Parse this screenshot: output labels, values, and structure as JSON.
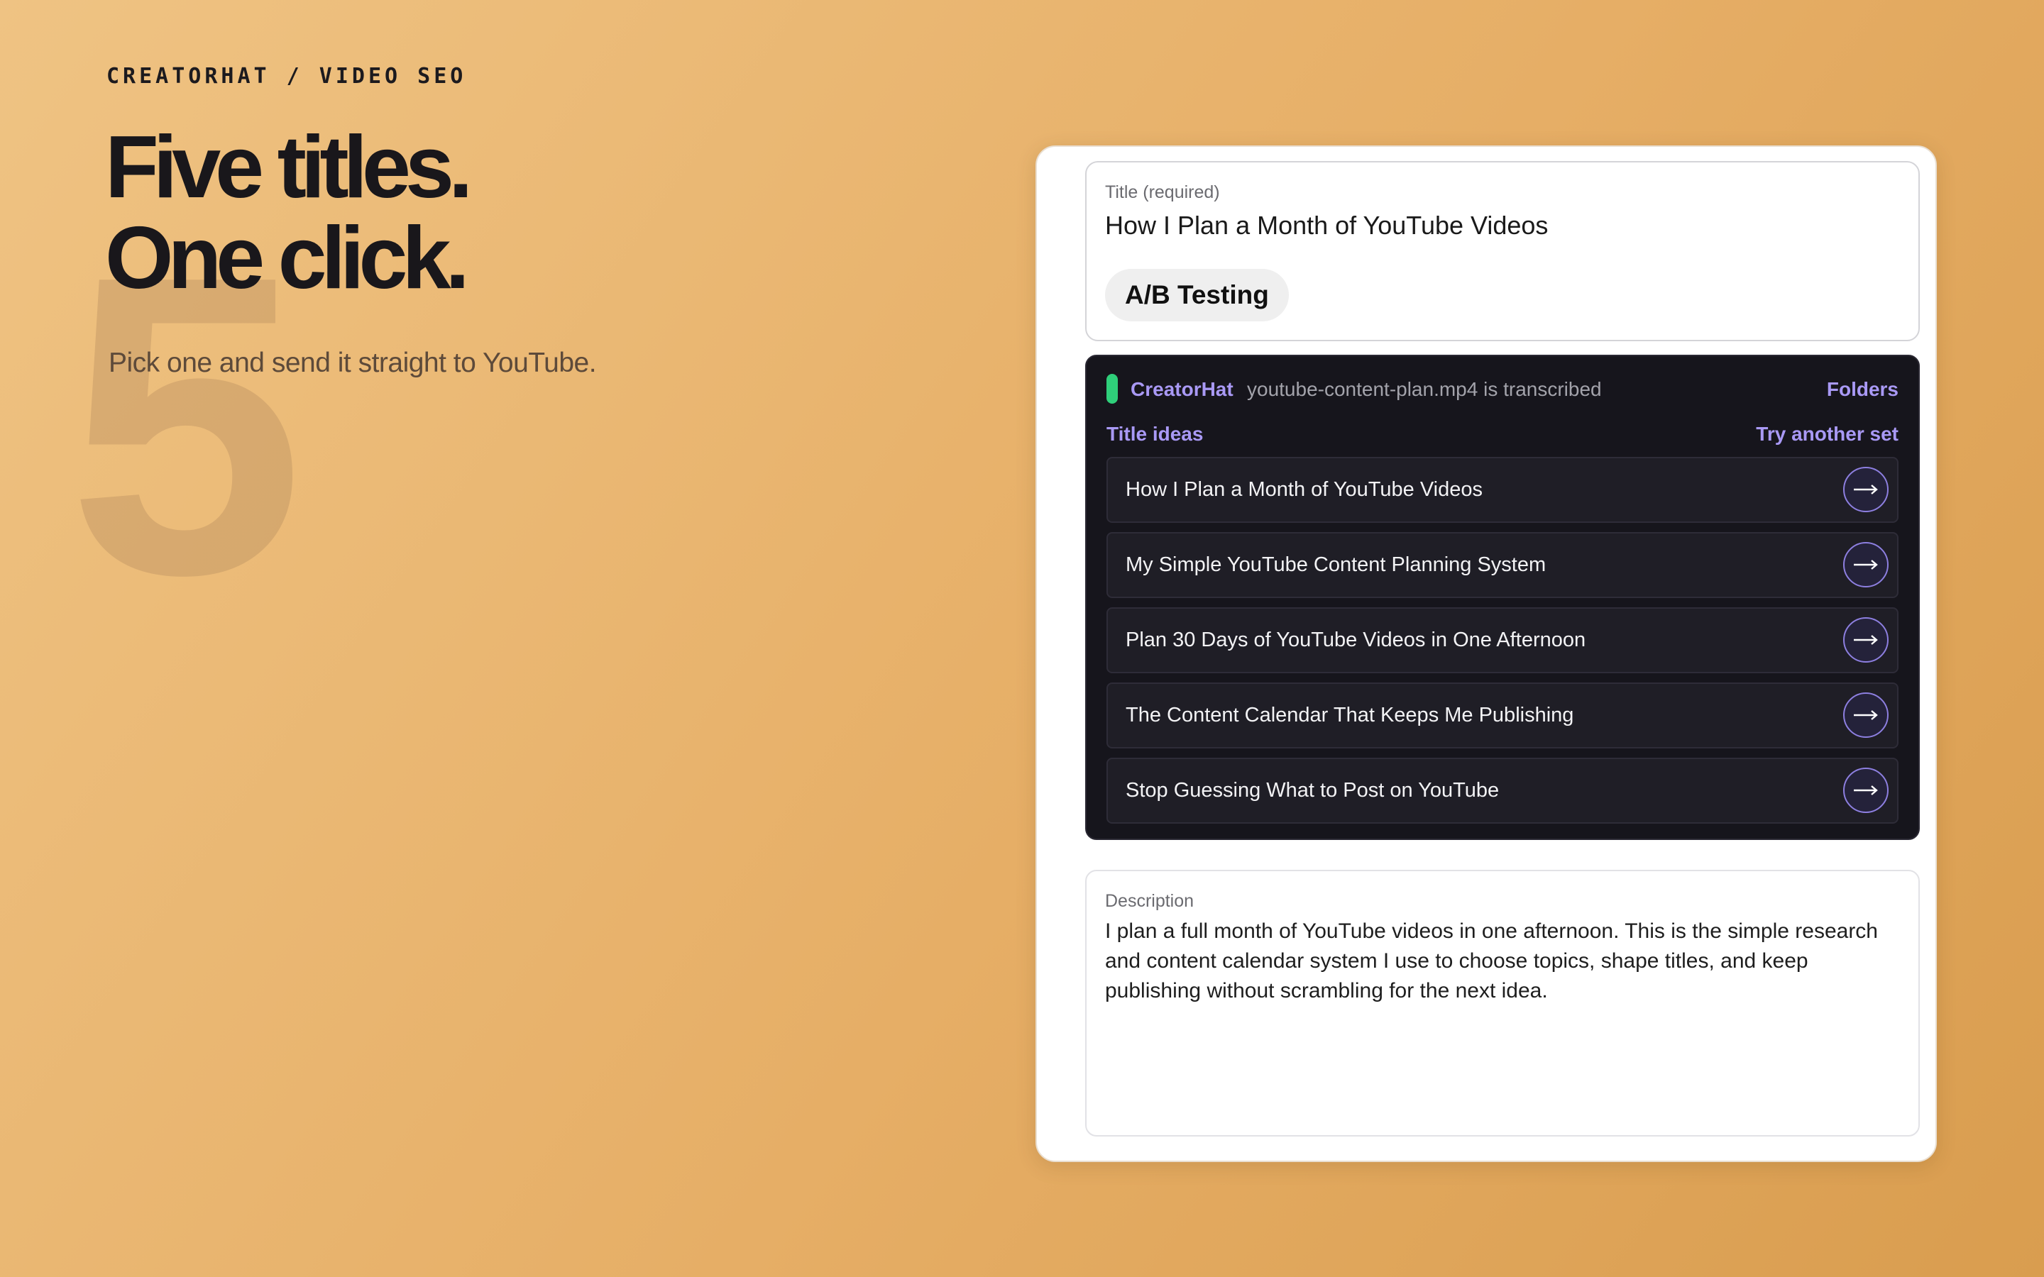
{
  "hero": {
    "eyebrow": "CREATORHAT / VIDEO SEO",
    "watermark_number": "5",
    "headline_line1": "Five titles.",
    "headline_line2": "One click.",
    "subhead": "Pick one and send it straight to YouTube."
  },
  "editor": {
    "title_label": "Title (required)",
    "title_value": "How I Plan a Month of YouTube Videos",
    "ab_testing_label": "A/B Testing",
    "assistant": {
      "brand": "CreatorHat",
      "status": "youtube-content-plan.mp4 is transcribed",
      "folders_link": "Folders",
      "ideas_heading": "Title ideas",
      "try_another_link": "Try another set",
      "status_color": "#2fcf7a",
      "accent_color": "#a999f5",
      "use_icon": "arrow-right-icon",
      "ideas": [
        {
          "text": "How I Plan a Month of YouTube Videos"
        },
        {
          "text": "My Simple YouTube Content Planning System"
        },
        {
          "text": "Plan 30 Days of YouTube Videos in One Afternoon"
        },
        {
          "text": "The Content Calendar That Keeps Me Publishing"
        },
        {
          "text": "Stop Guessing What to Post on YouTube"
        }
      ]
    },
    "description_label": "Description",
    "description_text": "I plan a full month of YouTube videos in one afternoon. This is the simple research and content calendar system I use to choose topics, shape titles, and keep publishing without scrambling for the next idea."
  }
}
